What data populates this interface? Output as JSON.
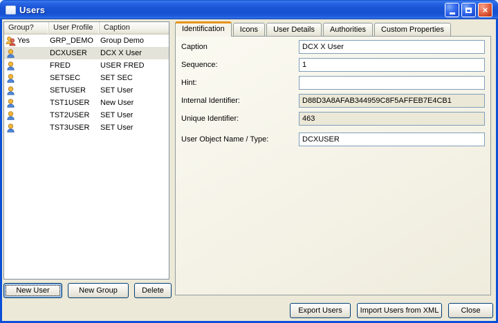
{
  "window": {
    "title": "Users"
  },
  "titlebar": {
    "icons": {
      "app": "window-icon",
      "minimize": "minimize-icon",
      "maximize": "maximize-icon",
      "close": "close-icon"
    }
  },
  "list": {
    "columns": [
      "Group?",
      "User Profile",
      "Caption"
    ],
    "rows": [
      {
        "type": "group",
        "group": "Yes",
        "profile": "GRP_DEMO",
        "caption": "Group Demo",
        "selected": false
      },
      {
        "type": "user",
        "group": "",
        "profile": "DCXUSER",
        "caption": "DCX X User",
        "selected": true
      },
      {
        "type": "user",
        "group": "",
        "profile": "FRED",
        "caption": "USER FRED",
        "selected": false
      },
      {
        "type": "user",
        "group": "",
        "profile": "SETSEC",
        "caption": "SET SEC",
        "selected": false
      },
      {
        "type": "user",
        "group": "",
        "profile": "SETUSER",
        "caption": "SET User",
        "selected": false
      },
      {
        "type": "user",
        "group": "",
        "profile": "TST1USER",
        "caption": "New User",
        "selected": false
      },
      {
        "type": "user",
        "group": "",
        "profile": "TST2USER",
        "caption": "SET User",
        "selected": false
      },
      {
        "type": "user",
        "group": "",
        "profile": "TST3USER",
        "caption": "SET User",
        "selected": false
      }
    ]
  },
  "left_buttons": {
    "new_user": "New User",
    "new_group": "New Group",
    "delete": "Delete"
  },
  "tabs": [
    {
      "label": "Identification",
      "active": true
    },
    {
      "label": "Icons",
      "active": false
    },
    {
      "label": "User Details",
      "active": false
    },
    {
      "label": "Authorities",
      "active": false
    },
    {
      "label": "Custom Properties",
      "active": false
    }
  ],
  "form": {
    "fields": [
      {
        "label": "Caption",
        "value": "DCX X User",
        "readonly": false
      },
      {
        "label": "Sequence:",
        "value": "1",
        "readonly": false
      },
      {
        "label": "Hint:",
        "value": "",
        "readonly": false
      },
      {
        "label": "Internal Identifier:",
        "value": "D88D3A8AFAB344959C8F5AFFEB7E4CB1",
        "readonly": true
      },
      {
        "label": "Unique Identifier:",
        "value": "463",
        "readonly": true
      },
      {
        "label": "User Object Name / Type:",
        "value": "DCXUSER",
        "readonly": false
      }
    ]
  },
  "bottom_buttons": {
    "export": "Export Users",
    "import": "Import Users from XML",
    "close": "Close"
  },
  "colors": {
    "titlebar_blue": "#1b56d7",
    "frame_blue": "#0b4fd7",
    "tab_accent_orange": "#e5941e",
    "dialog_bg": "#ece9d8",
    "readonly_bg": "#ebe8d7",
    "field_border": "#7f9db9",
    "selected_row": "#e4e3da"
  }
}
